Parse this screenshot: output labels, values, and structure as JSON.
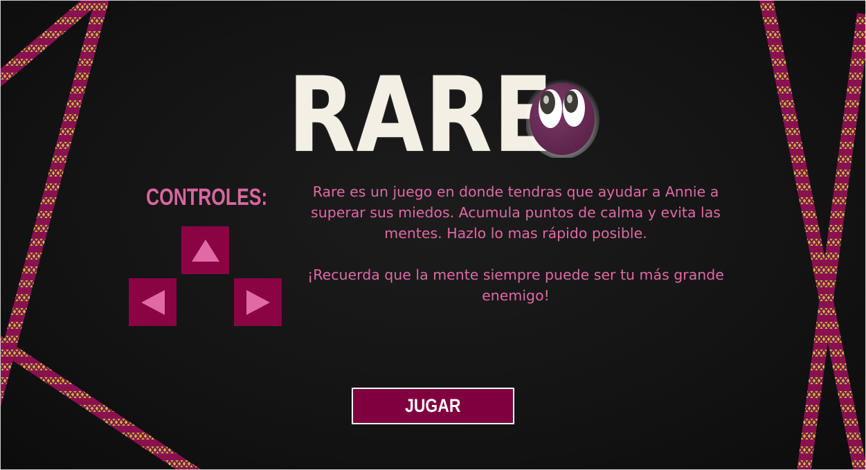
{
  "title": {
    "logo_text": "RARE",
    "mascot_icon": "purple-egg-eyes-icon"
  },
  "controls": {
    "title": "CONTROLES:",
    "keys": [
      {
        "icon": "arrow-up-icon"
      },
      {
        "icon": "arrow-left-icon"
      },
      {
        "icon": "arrow-right-icon"
      }
    ]
  },
  "description": {
    "intro": "Rare es un juego en donde tendras que ayudar a Annie a superar sus miedos. Acumula puntos de calma y evita las mentes. Hazlo lo mas rápido posible.",
    "reminder": "¡Recuerda que la mente siempre puede ser tu más grande enemigo!"
  },
  "play_button": {
    "label": "JUGAR"
  },
  "colors": {
    "background": "#121212",
    "accent_pink": "#e069a6",
    "key_maroon": "#8a0443",
    "button_maroon": "#80003f",
    "tape_magenta": "#8a1050",
    "tape_yellow": "#b8c23a",
    "logo_cream": "#f4efe5"
  }
}
